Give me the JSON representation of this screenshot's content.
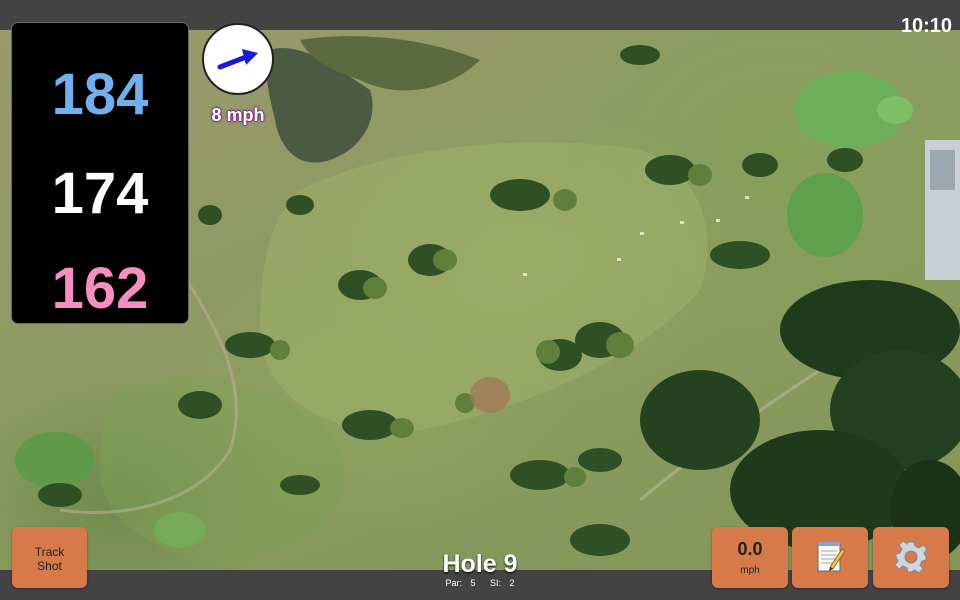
{
  "status": {
    "time": "10:10"
  },
  "distances": {
    "back": "184",
    "middle": "174",
    "front": "162"
  },
  "wind": {
    "speed": "8 mph",
    "icon": "arrow-right-up-icon",
    "arrow_color": "#1a1adc"
  },
  "hole": {
    "title": "Hole 9",
    "par_label": "Par:",
    "par": "5",
    "si_label": "SI:",
    "si": "2"
  },
  "buttons": {
    "track_shot_line1": "Track",
    "track_shot_line2": "Shot",
    "speed_value": "0.0",
    "speed_unit": "mph",
    "notes_icon": "notepad-icon",
    "settings_icon": "gear-icon"
  },
  "colors": {
    "back_distance": "#6fb0ee",
    "middle_distance": "#ffffff",
    "front_distance": "#f48fc0",
    "button": "#d67a4a",
    "bar": "#434343"
  }
}
